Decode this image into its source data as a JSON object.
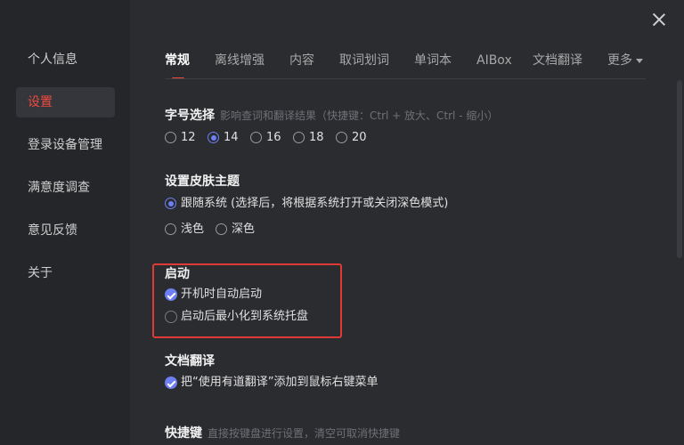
{
  "sidebar": {
    "items": [
      {
        "label": "个人信息"
      },
      {
        "label": "设置"
      },
      {
        "label": "登录设备管理"
      },
      {
        "label": "满意度调查"
      },
      {
        "label": "意见反馈"
      },
      {
        "label": "关于"
      }
    ],
    "active_index": 1
  },
  "tabs": [
    {
      "label": "常规"
    },
    {
      "label": "离线增强"
    },
    {
      "label": "内容"
    },
    {
      "label": "取词划词"
    },
    {
      "label": "单词本"
    },
    {
      "label": "AIBox"
    },
    {
      "label": "文档翻译"
    },
    {
      "label": "更多"
    }
  ],
  "font_size": {
    "title": "字号选择",
    "hint": "影响查词和翻译结果（快捷键：Ctrl + 放大、Ctrl - 缩小）",
    "options": [
      "12",
      "14",
      "16",
      "18",
      "20"
    ],
    "selected": "14"
  },
  "skin": {
    "title": "设置皮肤主题",
    "options": [
      "跟随系统 (选择后，将根据系统打开或关闭深色模式)",
      "浅色",
      "深色"
    ],
    "selected": "跟随系统 (选择后，将根据系统打开或关闭深色模式)"
  },
  "startup": {
    "title": "启动",
    "options": [
      {
        "label": "开机时自动启动",
        "checked": true
      },
      {
        "label": "启动后最小化到系统托盘",
        "checked": false
      }
    ]
  },
  "doc_translate": {
    "title": "文档翻译",
    "options": [
      {
        "label": "把“使用有道翻译”添加到鼠标右键菜单",
        "checked": true
      }
    ]
  },
  "shortcut": {
    "title": "快捷键",
    "hint": "直接按键盘进行设置，清空可取消快捷键"
  },
  "colors": {
    "accent": "#f04a3e",
    "control": "#6d7ff2",
    "highlight_box": "#e03a37"
  }
}
